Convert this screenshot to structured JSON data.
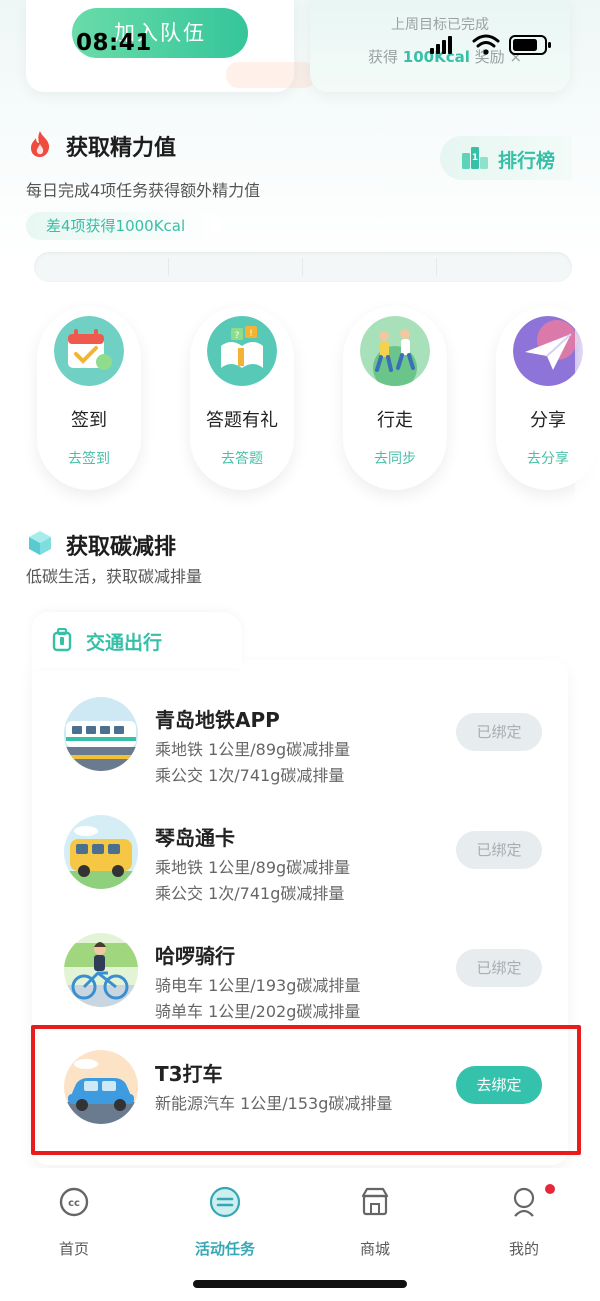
{
  "status_bar": {
    "time": "08:41"
  },
  "top_cards": {
    "join_button": "加入队伍",
    "last_week_text": "上周目标已完成",
    "reward_prefix": "获得",
    "reward_value": "100Kcal",
    "reward_suffix": "奖励"
  },
  "energy": {
    "title": "获取精力值",
    "subtitle": "每日完成4项任务获得额外精力值",
    "leaderboard": "排行榜",
    "remaining": "差4项获得1000Kcal",
    "tasks": [
      {
        "name": "签到",
        "action": "去签到",
        "icon": "calendar-check-icon"
      },
      {
        "name": "答题有礼",
        "action": "去答题",
        "icon": "quiz-book-icon"
      },
      {
        "name": "行走",
        "action": "去同步",
        "icon": "walking-people-icon"
      },
      {
        "name": "分享",
        "action": "去分享",
        "icon": "paper-plane-icon"
      }
    ]
  },
  "carbon": {
    "title": "获取碳减排",
    "subtitle": "低碳生活，获取碳减排量",
    "transport_tab": "交通出行",
    "apps": [
      {
        "name": "青岛地铁APP",
        "lines": [
          "乘地铁 1公里/89g碳减排量",
          "乘公交 1次/741g碳减排量"
        ],
        "button": "已绑定",
        "icon": "subway-train-icon"
      },
      {
        "name": "琴岛通卡",
        "lines": [
          "乘地铁 1公里/89g碳减排量",
          "乘公交 1次/741g碳减排量"
        ],
        "button": "已绑定",
        "icon": "bus-icon"
      },
      {
        "name": "哈啰骑行",
        "lines": [
          "骑电车 1公里/193g碳减排量",
          "骑单车 1公里/202g碳减排量"
        ],
        "button": "已绑定",
        "icon": "cyclist-icon"
      },
      {
        "name": "T3打车",
        "lines": [
          "新能源汽车 1公里/153g碳减排量"
        ],
        "button": "去绑定",
        "icon": "car-icon"
      }
    ]
  },
  "nav": {
    "items": [
      {
        "label": "首页",
        "icon": "home-face-icon"
      },
      {
        "label": "活动任务",
        "icon": "activity-task-icon"
      },
      {
        "label": "商城",
        "icon": "shop-icon"
      },
      {
        "label": "我的",
        "icon": "profile-icon"
      }
    ]
  },
  "colors": {
    "accent": "#37bfa7",
    "highlight": "#e81c1c",
    "badge": "#e8263a"
  }
}
